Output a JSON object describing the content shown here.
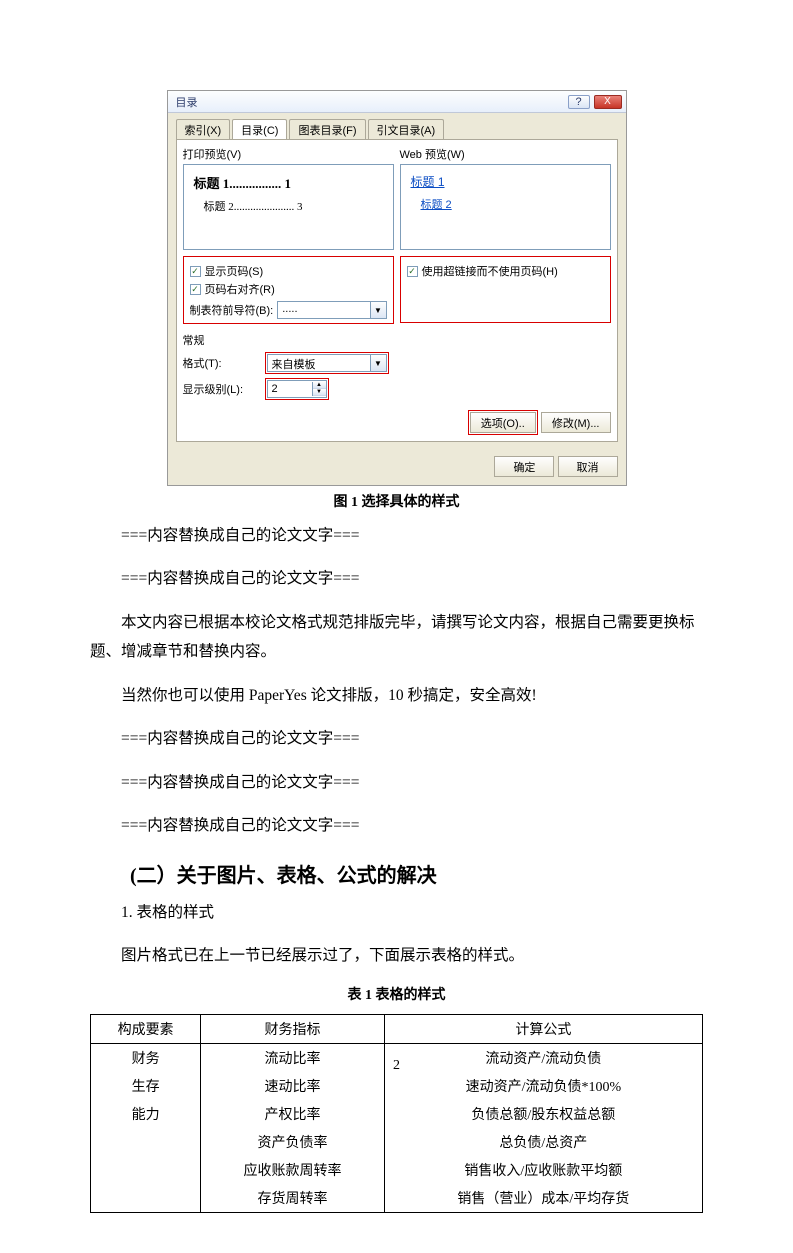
{
  "dialog": {
    "title": "目录",
    "help_btn": "?",
    "close_btn": "X",
    "tabs": [
      {
        "label": "索引(X)"
      },
      {
        "label": "目录(C)"
      },
      {
        "label": "图表目录(F)"
      },
      {
        "label": "引文目录(A)"
      }
    ],
    "print_preview_label": "打印预览(V)",
    "web_preview_label": "Web 预览(W)",
    "print_preview": {
      "line1_left": "标题 1",
      "line1_right": "1",
      "line2_left": "标题 2",
      "line2_right": "3"
    },
    "web_preview": {
      "link1": "标题 1",
      "link2": "标题 2"
    },
    "show_page_num": "显示页码(S)",
    "right_align": "页码右对齐(R)",
    "tab_leader_label": "制表符前导符(B):",
    "tab_leader_value": ".....",
    "use_hyperlink": "使用超链接而不使用页码(H)",
    "general_header": "常规",
    "format_label": "格式(T):",
    "format_value": "来自模板",
    "show_level_label": "显示级别(L):",
    "show_level_value": "2",
    "options_btn": "选项(O)..",
    "modify_btn": "修改(M)...",
    "ok_btn": "确定",
    "cancel_btn": "取消"
  },
  "fig_caption": "图 1  选择具体的样式",
  "para": {
    "p1": "===内容替换成自己的论文文字===",
    "p2": "===内容替换成自己的论文文字===",
    "p3": "本文内容已根据本校论文格式规范排版完毕，请撰写论文内容，根据自己需要更换标题、增减章节和替换内容。",
    "p4": "当然你也可以使用 PaperYes 论文排版，10 秒搞定，安全高效!",
    "p5": "===内容替换成自己的论文文字===",
    "p6": "===内容替换成自己的论文文字===",
    "p7": "===内容替换成自己的论文文字==="
  },
  "heading2": "(二）关于图片、表格、公式的解决",
  "heading3": "1. 表格的样式",
  "para8": "图片格式已在上一节已经展示过了，下面展示表格的样式。",
  "table_caption": "表 1  表格的样式",
  "table": {
    "headers": {
      "c1": "构成要素",
      "c2": "财务指标",
      "c3": "计算公式"
    },
    "col1": {
      "r1": "财务",
      "r2": "生存",
      "r3": "能力"
    },
    "rows": [
      {
        "indicator": "流动比率",
        "formula": "流动资产/流动负债"
      },
      {
        "indicator": "速动比率",
        "formula": "速动资产/流动负债*100%"
      },
      {
        "indicator": "产权比率",
        "formula": "负债总额/股东权益总额"
      },
      {
        "indicator": "资产负债率",
        "formula": "总负债/总资产"
      },
      {
        "indicator": "应收账款周转率",
        "formula": "销售收入/应收账款平均额"
      },
      {
        "indicator": "存货周转率",
        "formula": "销售（营业）成本/平均存货"
      }
    ]
  },
  "page_number": "2"
}
